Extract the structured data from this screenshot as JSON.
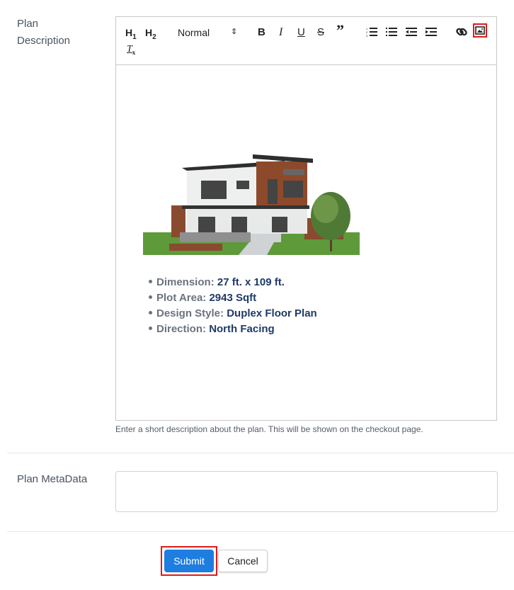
{
  "fields": {
    "description_label_line1": "Plan",
    "description_label_line2": "Description",
    "metadata_label": "Plan MetaData",
    "description_help": "Enter a short description about the plan. This will be shown on the checkout page."
  },
  "toolbar": {
    "h1": "H1",
    "h2": "H2",
    "format_select": "Normal",
    "bold": "B",
    "italic": "I",
    "underline": "U",
    "strike": "S",
    "quote": "”",
    "clear_format": "Tx",
    "icons": [
      "header-1-icon",
      "header-2-icon",
      "format-select",
      "bold-icon",
      "italic-icon",
      "underline-icon",
      "strikethrough-icon",
      "blockquote-icon",
      "ordered-list-icon",
      "bullet-list-icon",
      "outdent-icon",
      "indent-icon",
      "link-icon",
      "image-icon",
      "clear-format-icon"
    ]
  },
  "content": {
    "image_alt": "Duplex house exterior",
    "specs": [
      {
        "label": "Dimension:",
        "value": "27 ft. x 109 ft."
      },
      {
        "label": "Plot Area:",
        "value": "2943 Sqft"
      },
      {
        "label": "Design Style:",
        "value": "Duplex Floor Plan"
      },
      {
        "label": "Direction:",
        "value": "North Facing"
      }
    ]
  },
  "metadata": {
    "value": ""
  },
  "actions": {
    "submit": "Submit",
    "cancel": "Cancel"
  },
  "colors": {
    "primary": "#1e7de0",
    "highlight": "#e01b1b",
    "spec_value": "#1f3a68"
  }
}
